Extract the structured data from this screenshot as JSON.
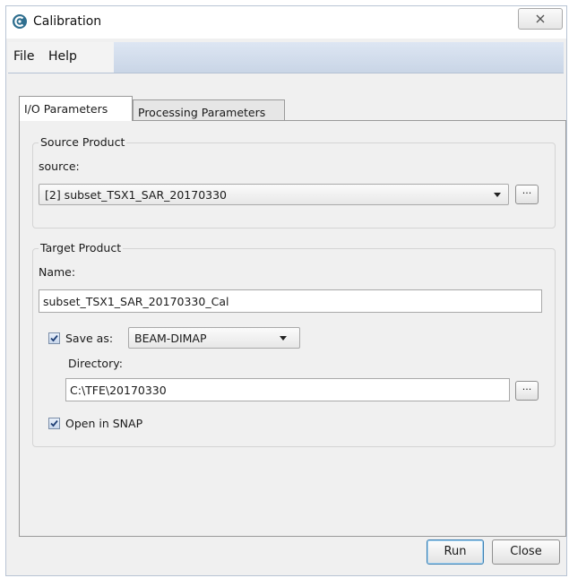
{
  "window": {
    "title": "Calibration",
    "close_glyph": "✕"
  },
  "menu": {
    "items": [
      "File",
      "Help"
    ]
  },
  "tabs": [
    {
      "label": "I/O Parameters",
      "active": true
    },
    {
      "label": "Processing Parameters",
      "active": false
    }
  ],
  "source_product": {
    "legend": "Source Product",
    "source_label": "source:",
    "source_value": "[2] subset_TSX1_SAR_20170330",
    "browse_label": "..."
  },
  "target_product": {
    "legend": "Target Product",
    "name_label": "Name:",
    "name_value": "subset_TSX1_SAR_20170330_Cal",
    "save_as_label": "Save as:",
    "save_as_checked": true,
    "format_value": "BEAM-DIMAP",
    "directory_label": "Directory:",
    "directory_value": "C:\\TFE\\20170330",
    "browse_label": "...",
    "open_in_snap_label": "Open in SNAP",
    "open_in_snap_checked": true
  },
  "buttons": {
    "run": "Run",
    "close": "Close"
  },
  "colors": {
    "menubar": "#c9d5e6",
    "app_icon": "#2f6f8f",
    "run_border": "#3c7fb1"
  },
  "icons": {
    "app": "calibration-app-icon",
    "close": "close-icon",
    "dropdown": "chevron-down-icon",
    "checkbox": "checkmark-icon"
  }
}
